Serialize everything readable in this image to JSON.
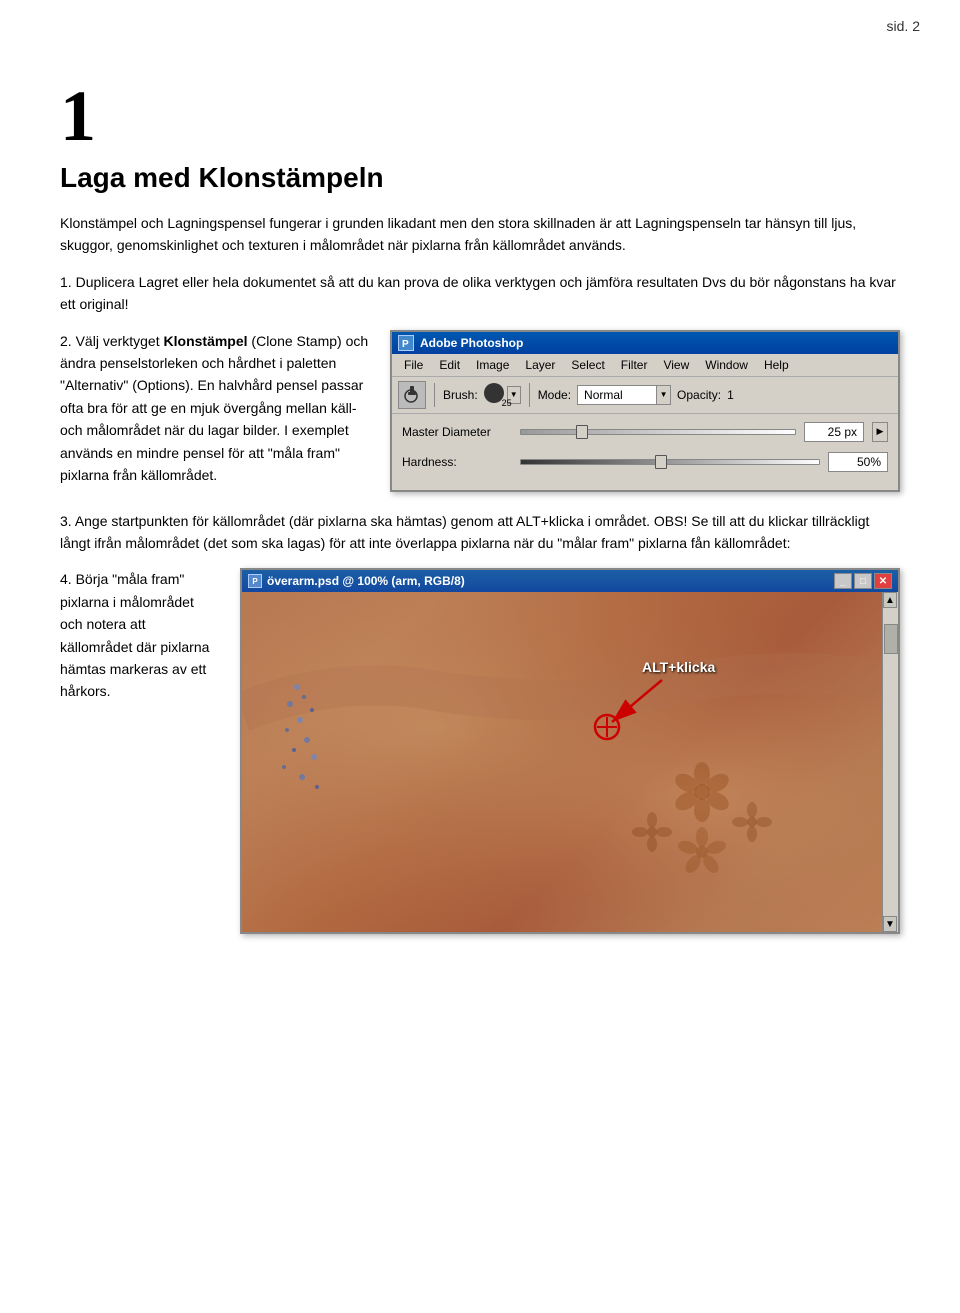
{
  "page": {
    "number": "sid. 2",
    "chapter_number": "1",
    "chapter_title": "Laga med Klonstämpeln",
    "intro_paragraph": "Klonstämpel och Lagningspensel fungerar i grunden likadant men den stora skillnaden är att Lagningspenseln tar hänsyn till ljus, skuggor, genomskinlighet och texturen i målområdet när pixlarna från källområdet används.",
    "step1_number": "1.",
    "step1_text": "Duplicera Lagret eller hela dokumentet så att du kan prova de olika verktygen och jämföra resultaten Dvs du bör någonstans ha kvar ett original!",
    "step2_number": "2.",
    "step2_text": "Välj verktyget ",
    "step2_bold": "Klonstämpel",
    "step2_text2": " (Clone Stamp) och ändra penselstorleken och hårdhet i paletten \"Alternativ\" (Options). En halvhård pensel passar ofta bra för att ge en mjuk övergång mellan käll- och målområdet när du lagar bilder. I exemplet används en mindre pensel för att \"måla fram\" pixlarna från källområdet.",
    "step3_number": "3.",
    "step3_text": "Ange startpunkten för källområdet (där pixlarna ska hämtas) genom att ALT+klicka i området. OBS! Se till att du klickar tillräckligt långt ifrån målområdet (det som ska lagas) för att inte överlappa pixlarna när du \"målar fram\" pixlarna fån källområdet:",
    "step4_number": "4.",
    "step4_text": "Börja \"måla fram\" pixlarna i målområdet och notera att källområdet där pixlarna hämtas markeras av ett hårkors."
  },
  "photoshop_window": {
    "title": "Adobe Photoshop",
    "menu_items": [
      "File",
      "Edit",
      "Image",
      "Layer",
      "Select",
      "Filter",
      "View",
      "Window",
      "Help"
    ],
    "brush_label": "Brush:",
    "brush_size": "25",
    "mode_label": "Mode:",
    "mode_value": "Normal",
    "opacity_label": "Opacity:",
    "opacity_value": "1",
    "master_diameter_label": "Master Diameter",
    "master_diameter_value": "25 px",
    "hardness_label": "Hardness:",
    "hardness_value": "50%"
  },
  "arm_window": {
    "title": "överarm.psd @ 100% (arm, RGB/8)",
    "alt_click_label": "ALT+klicka"
  }
}
